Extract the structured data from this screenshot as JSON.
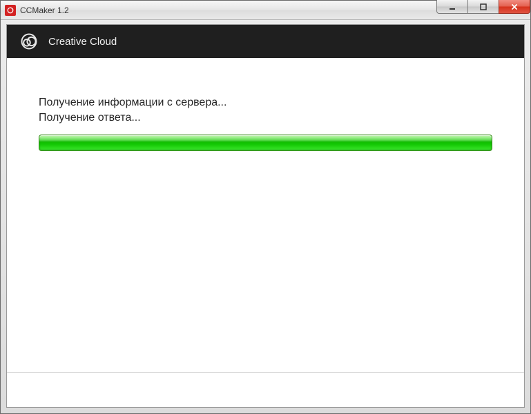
{
  "window": {
    "title": "CCMaker 1.2"
  },
  "header": {
    "product_name": "Creative Cloud"
  },
  "status": {
    "line1": "Получение информации с сервера...",
    "line2": "Получение ответа..."
  },
  "progress": {
    "percent": 100
  },
  "icons": {
    "app": "app-icon",
    "cc_logo": "creative-cloud-logo",
    "minimize": "minimize-icon",
    "maximize": "maximize-icon",
    "close": "close-icon"
  }
}
